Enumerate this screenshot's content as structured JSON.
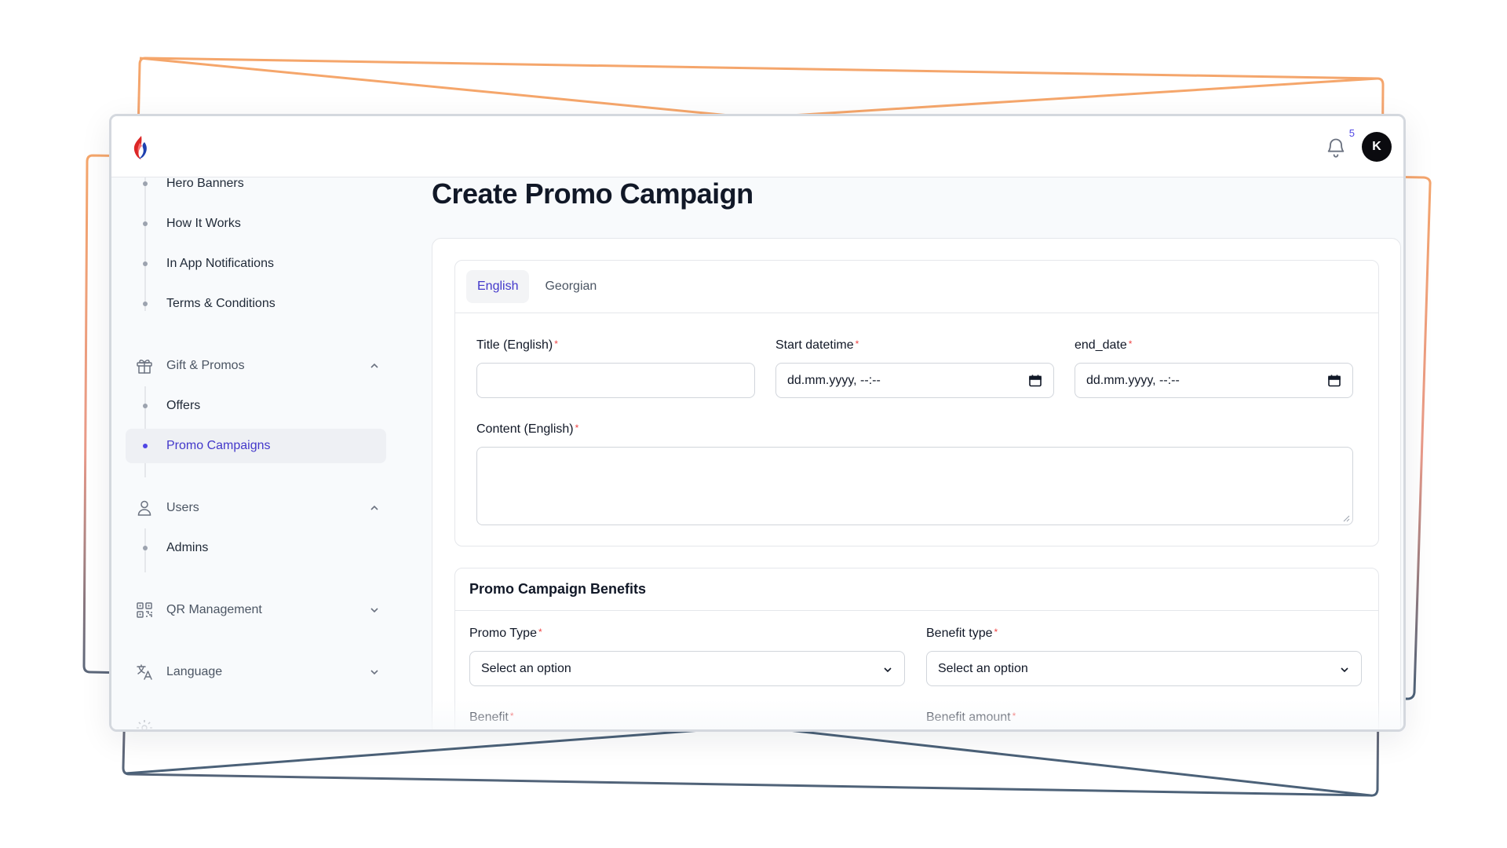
{
  "topbar": {
    "notification_count": "5",
    "avatar_initial": "K"
  },
  "sidebar": {
    "content_items": [
      "Hero Banners",
      "How It Works",
      "In App Notifications",
      "Terms & Conditions"
    ],
    "gift_group": {
      "label": "Gift & Promos",
      "items": [
        "Offers",
        "Promo Campaigns"
      ],
      "active": "Promo Campaigns"
    },
    "users_group": {
      "label": "Users",
      "items": [
        "Admins"
      ]
    },
    "qr_group": {
      "label": "QR Management"
    },
    "language_group": {
      "label": "Language"
    }
  },
  "page": {
    "title": "Create Promo Campaign"
  },
  "form": {
    "tabs": [
      "English",
      "Georgian"
    ],
    "active_tab": "English",
    "title_label": "Title (English)",
    "start_label": "Start datetime",
    "end_label": "end_date",
    "datetime_placeholder": "dd.mm.yyyy, --:--",
    "content_label": "Content (English)",
    "required_mark": "*"
  },
  "benefits": {
    "title": "Promo Campaign Benefits",
    "promo_type_label": "Promo Type",
    "benefit_type_label": "Benefit type",
    "select_placeholder": "Select an option",
    "benefit_label": "Benefit",
    "benefit_amount_label": "Benefit amount"
  },
  "colors": {
    "accent": "#4f46e5",
    "required": "#ef4444",
    "frame_orange": "#f5a66b",
    "frame_slate": "#4b6178"
  }
}
